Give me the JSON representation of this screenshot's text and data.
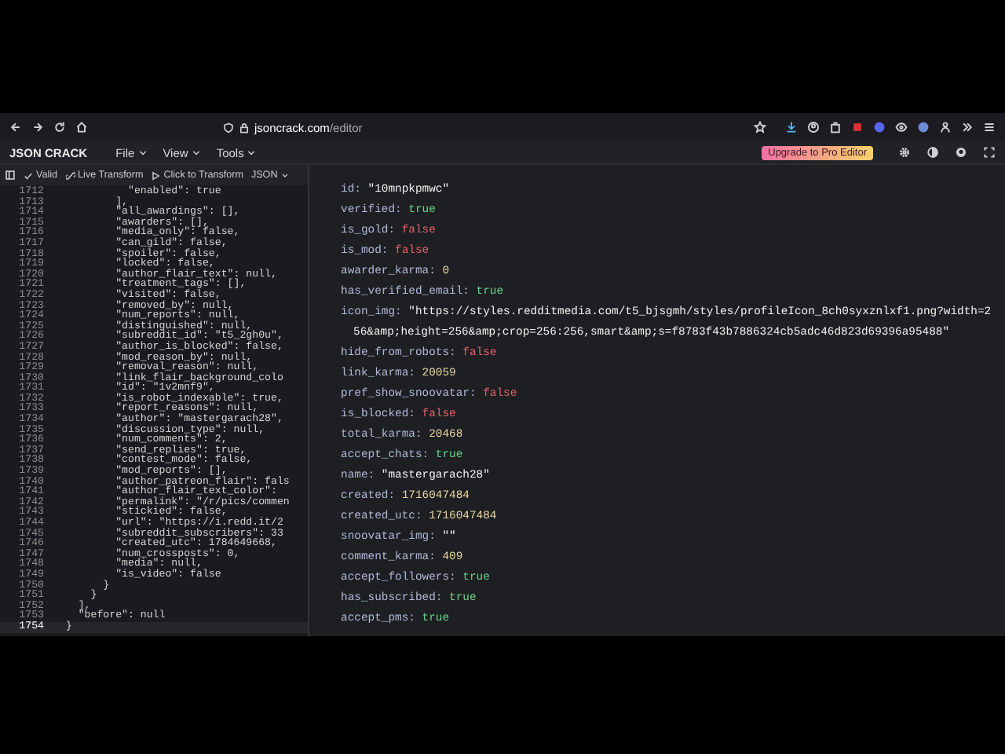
{
  "browser": {
    "url_host": "jsoncrack.com",
    "url_path": "/editor"
  },
  "app": {
    "logo": "JSON CRACK",
    "menus": [
      "File",
      "View",
      "Tools"
    ],
    "upgrade_button": "Upgrade to Pro Editor"
  },
  "toolbar": {
    "valid": "Valid",
    "live_transform": "Live Transform",
    "click_transform": "Click to Transform",
    "format": "JSON"
  },
  "editor": {
    "lines": [
      {
        "number": "1712",
        "text": "            \"enabled\": true",
        "current": false
      },
      {
        "number": "1713",
        "text": "          ],",
        "current": false
      },
      {
        "number": "1714",
        "text": "          \"all_awardings\": [],",
        "current": false
      },
      {
        "number": "1715",
        "text": "          \"awarders\": [],",
        "current": false
      },
      {
        "number": "1716",
        "text": "          \"media_only\": false,",
        "current": false
      },
      {
        "number": "1717",
        "text": "          \"can_gild\": false,",
        "current": false
      },
      {
        "number": "1718",
        "text": "          \"spoiler\": false,",
        "current": false
      },
      {
        "number": "1719",
        "text": "          \"locked\": false,",
        "current": false
      },
      {
        "number": "1720",
        "text": "          \"author_flair_text\": null,",
        "current": false
      },
      {
        "number": "1721",
        "text": "          \"treatment_tags\": [],",
        "current": false
      },
      {
        "number": "1722",
        "text": "          \"visited\": false,",
        "current": false
      },
      {
        "number": "1723",
        "text": "          \"removed_by\": null,",
        "current": false
      },
      {
        "number": "1724",
        "text": "          \"num_reports\": null,",
        "current": false
      },
      {
        "number": "1725",
        "text": "          \"distinguished\": null,",
        "current": false
      },
      {
        "number": "1726",
        "text": "          \"subreddit_id\": \"t5_2gh0u\",",
        "current": false
      },
      {
        "number": "1727",
        "text": "          \"author_is_blocked\": false,",
        "current": false
      },
      {
        "number": "1728",
        "text": "          \"mod_reason_by\": null,",
        "current": false
      },
      {
        "number": "1729",
        "text": "          \"removal_reason\": null,",
        "current": false
      },
      {
        "number": "1730",
        "text": "          \"link_flair_background_colo",
        "current": false
      },
      {
        "number": "1731",
        "text": "          \"id\": \"1v2mnf9\",",
        "current": false
      },
      {
        "number": "1732",
        "text": "          \"is_robot_indexable\": true,",
        "current": false
      },
      {
        "number": "1733",
        "text": "          \"report_reasons\": null,",
        "current": false
      },
      {
        "number": "1734",
        "text": "          \"author\": \"mastergarach28\",",
        "current": false
      },
      {
        "number": "1735",
        "text": "          \"discussion_type\": null,",
        "current": false
      },
      {
        "number": "1736",
        "text": "          \"num_comments\": 2,",
        "current": false
      },
      {
        "number": "1737",
        "text": "          \"send_replies\": true,",
        "current": false
      },
      {
        "number": "1738",
        "text": "          \"contest_mode\": false,",
        "current": false
      },
      {
        "number": "1739",
        "text": "          \"mod_reports\": [],",
        "current": false
      },
      {
        "number": "1740",
        "text": "          \"author_patreon_flair\": fals",
        "current": false
      },
      {
        "number": "1741",
        "text": "          \"author_flair_text_color\":",
        "current": false
      },
      {
        "number": "1742",
        "text": "          \"permalink\": \"/r/pics/commen",
        "current": false
      },
      {
        "number": "1743",
        "text": "          \"stickied\": false,",
        "current": false
      },
      {
        "number": "1744",
        "text": "          \"url\": \"https://i.redd.it/2",
        "current": false
      },
      {
        "number": "1745",
        "text": "          \"subreddit_subscribers\": 33",
        "current": false
      },
      {
        "number": "1746",
        "text": "          \"created_utc\": 1784649668,",
        "current": false
      },
      {
        "number": "1747",
        "text": "          \"num_crossposts\": 0,",
        "current": false
      },
      {
        "number": "1748",
        "text": "          \"media\": null,",
        "current": false
      },
      {
        "number": "1749",
        "text": "          \"is_video\": false",
        "current": false
      },
      {
        "number": "1750",
        "text": "        }",
        "current": false
      },
      {
        "number": "1751",
        "text": "      }",
        "current": false
      },
      {
        "number": "1752",
        "text": "    ],",
        "current": false
      },
      {
        "number": "1753",
        "text": "    \"before\": null",
        "current": false
      },
      {
        "number": "1754",
        "text": "  }",
        "current": true
      }
    ]
  },
  "details": {
    "fields": [
      {
        "key": "id:",
        "value": "\"10mnpkpmwc\"",
        "kind": "string"
      },
      {
        "key": "verified:",
        "value": "true",
        "kind": "true"
      },
      {
        "key": "is_gold:",
        "value": "false",
        "kind": "false"
      },
      {
        "key": "is_mod:",
        "value": "false",
        "kind": "false"
      },
      {
        "key": "awarder_karma:",
        "value": "0",
        "kind": "number"
      },
      {
        "key": "has_verified_email:",
        "value": "true",
        "kind": "true"
      },
      {
        "key": "icon_img:",
        "value": "\"https://styles.redditmedia.com/t5_bjsgmh/styles/profileIcon_8ch0syxznlxf1.png?width=256&amp;height=256&amp;crop=256:256,smart&amp;s=f8783f43b7886324cb5adc46d823d69396a95488\"",
        "kind": "string"
      },
      {
        "key": "hide_from_robots:",
        "value": "false",
        "kind": "false"
      },
      {
        "key": "link_karma:",
        "value": "20059",
        "kind": "number"
      },
      {
        "key": "pref_show_snoovatar:",
        "value": "false",
        "kind": "false"
      },
      {
        "key": "is_blocked:",
        "value": "false",
        "kind": "false"
      },
      {
        "key": "total_karma:",
        "value": "20468",
        "kind": "number"
      },
      {
        "key": "accept_chats:",
        "value": "true",
        "kind": "true"
      },
      {
        "key": "name:",
        "value": "\"mastergarach28\"",
        "kind": "string"
      },
      {
        "key": "created:",
        "value": "1716047484",
        "kind": "number"
      },
      {
        "key": "created_utc:",
        "value": "1716047484",
        "kind": "number"
      },
      {
        "key": "snoovatar_img:",
        "value": "\"\"",
        "kind": "string"
      },
      {
        "key": "comment_karma:",
        "value": "409",
        "kind": "number"
      },
      {
        "key": "accept_followers:",
        "value": "true",
        "kind": "true"
      },
      {
        "key": "has_subscribed:",
        "value": "true",
        "kind": "true"
      },
      {
        "key": "accept_pms:",
        "value": "true",
        "kind": "true"
      }
    ]
  }
}
